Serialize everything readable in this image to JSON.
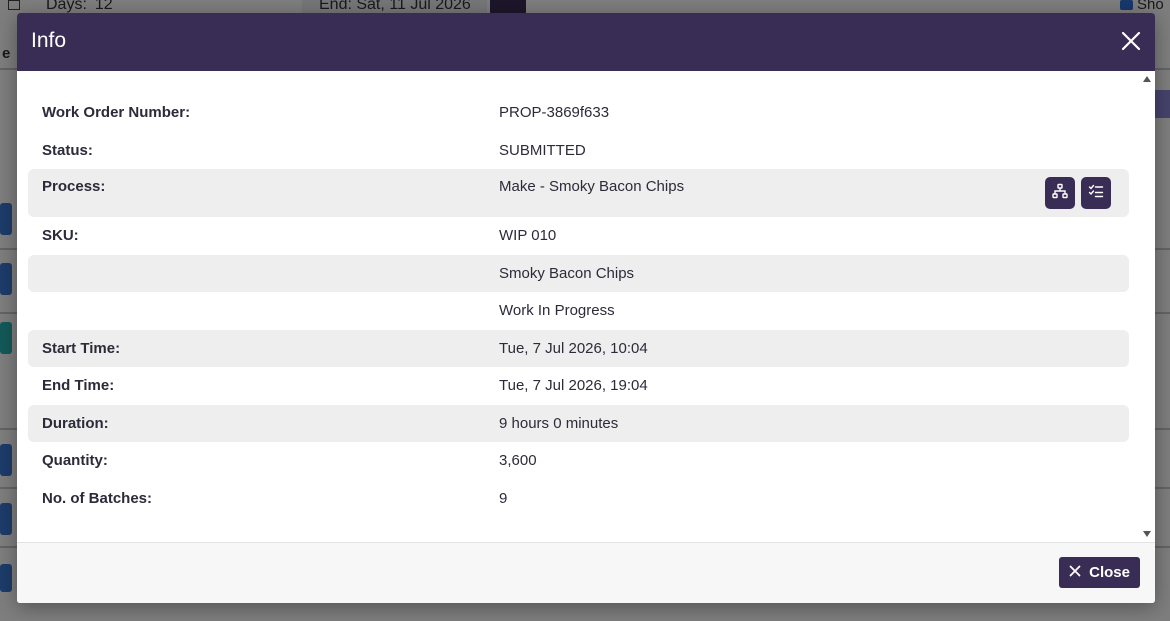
{
  "background": {
    "days_label": "Days:",
    "days_value": "12",
    "end_label": "End: Sat, 11 Jul 2026",
    "show_label": "Sho",
    "e_label": "e"
  },
  "modal": {
    "title": "Info",
    "rows": [
      {
        "label": "Work Order Number:",
        "value": "PROP-3869f633"
      },
      {
        "label": "Status:",
        "value": "SUBMITTED"
      },
      {
        "label": "Process:",
        "value": "Make - Smoky Bacon Chips"
      },
      {
        "label": "SKU:",
        "value": "WIP 010"
      },
      {
        "label": "",
        "value": "Smoky Bacon Chips"
      },
      {
        "label": "",
        "value": "Work In Progress"
      },
      {
        "label": "Start Time:",
        "value": "Tue, 7 Jul 2026, 10:04"
      },
      {
        "label": "End Time:",
        "value": "Tue, 7 Jul 2026, 19:04"
      },
      {
        "label": "Duration:",
        "value": "9 hours 0 minutes"
      },
      {
        "label": "Quantity:",
        "value": "3,600"
      },
      {
        "label": "No. of Batches:",
        "value": "9"
      }
    ],
    "close_label": "Close"
  },
  "icons": {
    "process_tree": "sitemap-icon",
    "process_checklist": "checklist-icon",
    "close": "close-icon"
  },
  "colors": {
    "header": "#3a2d55",
    "row_shade": "#eeeeee",
    "overlay": "rgba(0,0,0,0.5)"
  }
}
